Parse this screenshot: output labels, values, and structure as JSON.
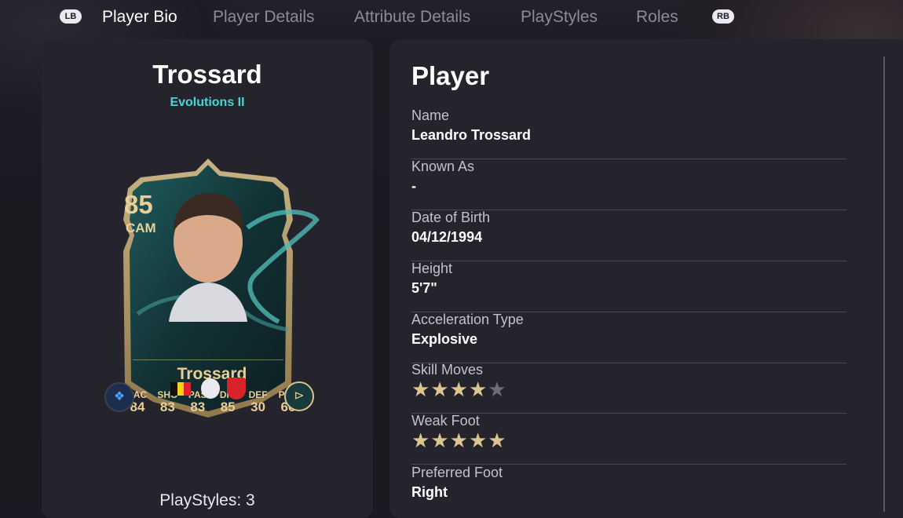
{
  "nav": {
    "lb": "LB",
    "rb": "RB",
    "tabs": [
      "Player Bio",
      "Player Details",
      "Attribute Details",
      "PlayStyles",
      "Roles"
    ],
    "active_tab": "Player Bio"
  },
  "card": {
    "title": "Trossard",
    "subtitle": "Evolutions II",
    "rating": "85",
    "position": "CAM",
    "name": "Trossard",
    "stats": [
      {
        "label": "PAC",
        "value": "84"
      },
      {
        "label": "SHO",
        "value": "83"
      },
      {
        "label": "PAS",
        "value": "83"
      },
      {
        "label": "DRI",
        "value": "85"
      },
      {
        "label": "DEF",
        "value": "30"
      },
      {
        "label": "PHY",
        "value": "66"
      }
    ],
    "playstyles_text": "PlayStyles: 3",
    "colors": {
      "gold": "#e8cf97",
      "teal": "#46d6d6",
      "card_bg": "#163a3e"
    }
  },
  "player": {
    "section_title": "Player",
    "fields": [
      {
        "label": "Name",
        "value": "Leandro Trossard"
      },
      {
        "label": "Known As",
        "value": "-"
      },
      {
        "label": "Date of Birth",
        "value": "04/12/1994"
      },
      {
        "label": "Height",
        "value": "5'7\""
      },
      {
        "label": "Acceleration Type",
        "value": "Explosive"
      },
      {
        "label": "Skill Moves",
        "stars": 4,
        "max": 5
      },
      {
        "label": "Weak Foot",
        "stars": 5,
        "max": 5
      },
      {
        "label": "Preferred Foot",
        "value": "Right"
      }
    ]
  }
}
